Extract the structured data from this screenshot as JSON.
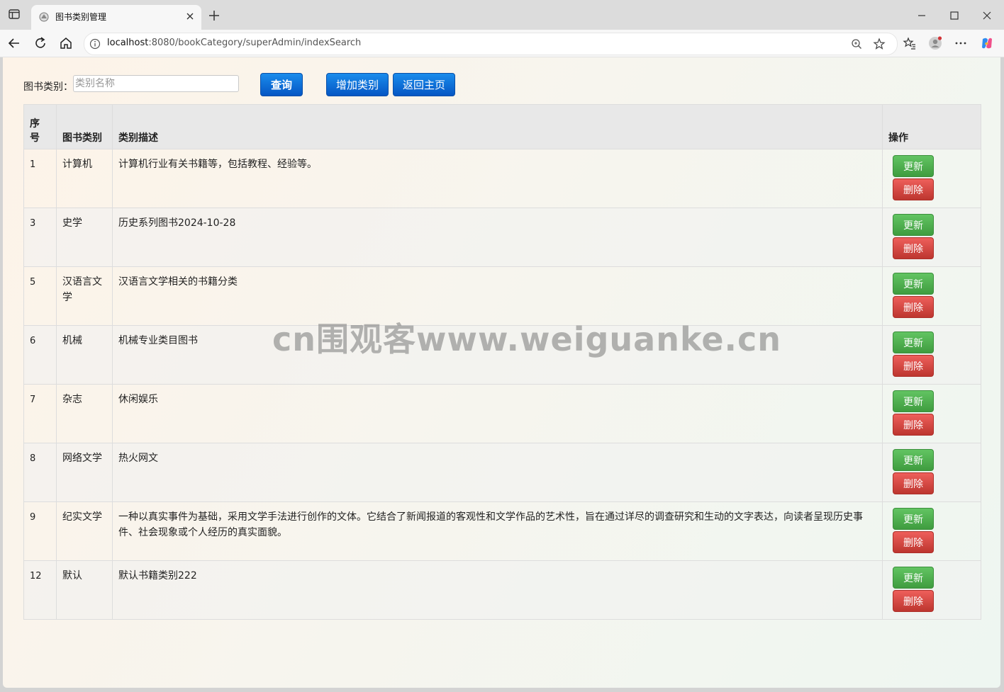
{
  "browser": {
    "tab_title": "图书类别管理",
    "url_host": "localhost",
    "url_path": ":8080/bookCategory/superAdmin/indexSearch"
  },
  "search": {
    "label": "图书类别：",
    "placeholder": "类别名称",
    "value": "",
    "query_button": "查询",
    "add_button": "增加类别",
    "home_button": "返回主页"
  },
  "table": {
    "headers": {
      "id": "序号",
      "category": "图书类别",
      "description": "类别描述",
      "actions": "操作"
    },
    "update_label": "更新",
    "delete_label": "删除",
    "rows": [
      {
        "id": "1",
        "category": "计算机",
        "description": "计算机行业有关书籍等，包括教程、经验等。"
      },
      {
        "id": "3",
        "category": "史学",
        "description": "历史系列图书2024-10-28"
      },
      {
        "id": "5",
        "category": "汉语言文学",
        "description": "汉语言文学相关的书籍分类"
      },
      {
        "id": "6",
        "category": "机械",
        "description": "机械专业类目图书"
      },
      {
        "id": "7",
        "category": "杂志",
        "description": "休闲娱乐"
      },
      {
        "id": "8",
        "category": "网络文学",
        "description": "热火网文"
      },
      {
        "id": "9",
        "category": "纪实文学",
        "description": "一种以真实事件为基础，采用文学手法进行创作的文体。它结合了新闻报道的客观性和文学作品的艺术性，旨在通过详尽的调查研究和生动的文字表达，向读者呈现历史事件、社会现象或个人经历的真实面貌。"
      },
      {
        "id": "12",
        "category": "默认",
        "description": "默认书籍类别222"
      }
    ]
  },
  "watermark": "cn围观客www.weiguanke.cn",
  "colors": {
    "primary_blue": "#0d6fd9",
    "update_green": "#51b051",
    "delete_red": "#d9534f"
  }
}
